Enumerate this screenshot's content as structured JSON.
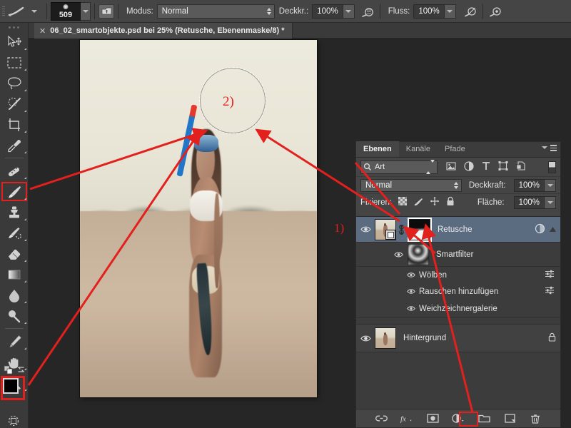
{
  "options_bar": {
    "brush_preview_icon": "brush-stroke-icon",
    "preset_dropdown_icon": "chevron-down-icon",
    "brush_size": "509",
    "brush_size_dropdown_icon": "chevron-down-icon",
    "brush_panel_icon": "brush-panel-icon",
    "mode_label": "Modus:",
    "mode_value": "Normal",
    "opacity_label": "Deckkr.:",
    "opacity_value": "100%",
    "pressure_opacity_icon": "airbrush-pressure-icon",
    "flow_label": "Fluss:",
    "flow_value": "100%",
    "airbrush_icon": "airbrush-icon",
    "smoothing_icon": "smoothing-icon",
    "tablet_pressure_icon": "tablet-pressure-icon"
  },
  "tab": {
    "close_icon": "close-icon",
    "title": "06_02_smartobjekte.psd bei 25% (Retusche, Ebenenmaske/8) *"
  },
  "tools": [
    {
      "name": "move-tool",
      "icon": "move-icon",
      "selected": false
    },
    {
      "name": "marquee-tool",
      "icon": "rectangular-marquee-icon",
      "selected": false
    },
    {
      "name": "lasso-tool",
      "icon": "lasso-icon",
      "selected": false
    },
    {
      "name": "quick-selection-tool",
      "icon": "quick-selection-icon",
      "selected": false
    },
    {
      "name": "crop-tool",
      "icon": "crop-icon",
      "selected": false
    },
    {
      "name": "eyedropper-tool",
      "icon": "eyedropper-icon",
      "selected": false
    },
    {
      "name": "healing-brush-tool",
      "icon": "healing-brush-icon",
      "selected": false
    },
    {
      "name": "brush-tool",
      "icon": "brush-icon",
      "selected": true
    },
    {
      "name": "clone-stamp-tool",
      "icon": "clone-stamp-icon",
      "selected": false
    },
    {
      "name": "history-brush-tool",
      "icon": "history-brush-icon",
      "selected": false
    },
    {
      "name": "eraser-tool",
      "icon": "eraser-icon",
      "selected": false
    },
    {
      "name": "gradient-tool",
      "icon": "gradient-icon",
      "selected": false
    },
    {
      "name": "blur-tool",
      "icon": "blur-drop-icon",
      "selected": false
    },
    {
      "name": "dodge-tool",
      "icon": "dodge-icon",
      "selected": false
    },
    {
      "name": "pen-tool",
      "icon": "pen-icon",
      "selected": false
    },
    {
      "name": "hand-tool",
      "icon": "hand-icon",
      "selected": false
    },
    {
      "name": "zoom-tool",
      "icon": "magnifier-icon",
      "selected": false
    }
  ],
  "swatches": {
    "foreground_color": "#000000",
    "background_color": "#ffffff",
    "default_colors_icon": "default-colors-icon",
    "swap-colors-icon": "swap-colors-icon",
    "quick-mask-icon": "quick-mask-icon",
    "highlight_color": "#e2201e"
  },
  "layers_panel": {
    "tabs": [
      {
        "label": "Ebenen",
        "active": true
      },
      {
        "label": "Kanäle",
        "active": false
      },
      {
        "label": "Pfade",
        "active": false
      }
    ],
    "menu_icon": "panel-menu-icon",
    "filter": {
      "search_icon": "search-icon",
      "kind_value": "Art",
      "kind_arrows_icon": "stepper-arrows-icon",
      "icons": [
        "pixel-layer-filter-icon",
        "adjustment-layer-filter-icon",
        "type-layer-filter-icon",
        "shape-layer-filter-icon",
        "smart-object-filter-icon"
      ],
      "toggle_icon": "filter-toggle-icon"
    },
    "blend_mode_value": "Normal",
    "blend_mode_arrows_icon": "stepper-arrows-icon",
    "opacity_label": "Deckkraft:",
    "opacity_value": "100%",
    "opacity_dropdown_icon": "chevron-down-icon",
    "lock_label": "Fixieren:",
    "lock_icons": [
      "lock-transparency-icon",
      "lock-image-icon",
      "lock-position-icon",
      "lock-all-icon"
    ],
    "fill_label": "Fläche:",
    "fill_value": "100%",
    "fill_dropdown_icon": "chevron-down-icon",
    "layers": [
      {
        "name": "Retusche",
        "selected": true,
        "visibility_icon": "eye-icon",
        "thumbnail": "smart-object-thumbnail",
        "link_icon": "link-mask-icon",
        "mask": "layer-mask-thumbnail",
        "right_icon": "smart-filter-badge-icon",
        "expand_icon": "collapse-triangle-icon"
      },
      {
        "name": "Smartfilter",
        "visibility_icon": "eye-icon",
        "thumbnail": "smart-filter-mask-thumbnail"
      },
      {
        "name": "Wölben",
        "visibility_icon": "eye-icon",
        "settings_icon": "filter-settings-icon"
      },
      {
        "name": "Rauschen hinzufügen",
        "visibility_icon": "eye-icon",
        "settings_icon": "filter-settings-icon"
      },
      {
        "name": "Weichzeichnergalerie",
        "visibility_icon": "eye-icon"
      },
      {
        "name": "Hintergrund",
        "visibility_icon": "eye-icon",
        "thumbnail": "background-thumbnail",
        "lock_icon": "lock-icon"
      }
    ],
    "footer_buttons": [
      "link-layers-icon",
      "layer-style-fx-icon",
      "add-layer-mask-icon",
      "new-adjustment-layer-icon",
      "new-group-icon",
      "new-layer-icon",
      "delete-layer-icon"
    ],
    "highlighted_footer_button": "add-layer-mask-icon"
  },
  "annotations": {
    "step_1": "1)",
    "step_2": "2)",
    "color": "#e2201e",
    "arrow_count": 5
  },
  "canvas": {
    "zoom": "25%",
    "brush_cursor": "round-brush-cursor"
  }
}
